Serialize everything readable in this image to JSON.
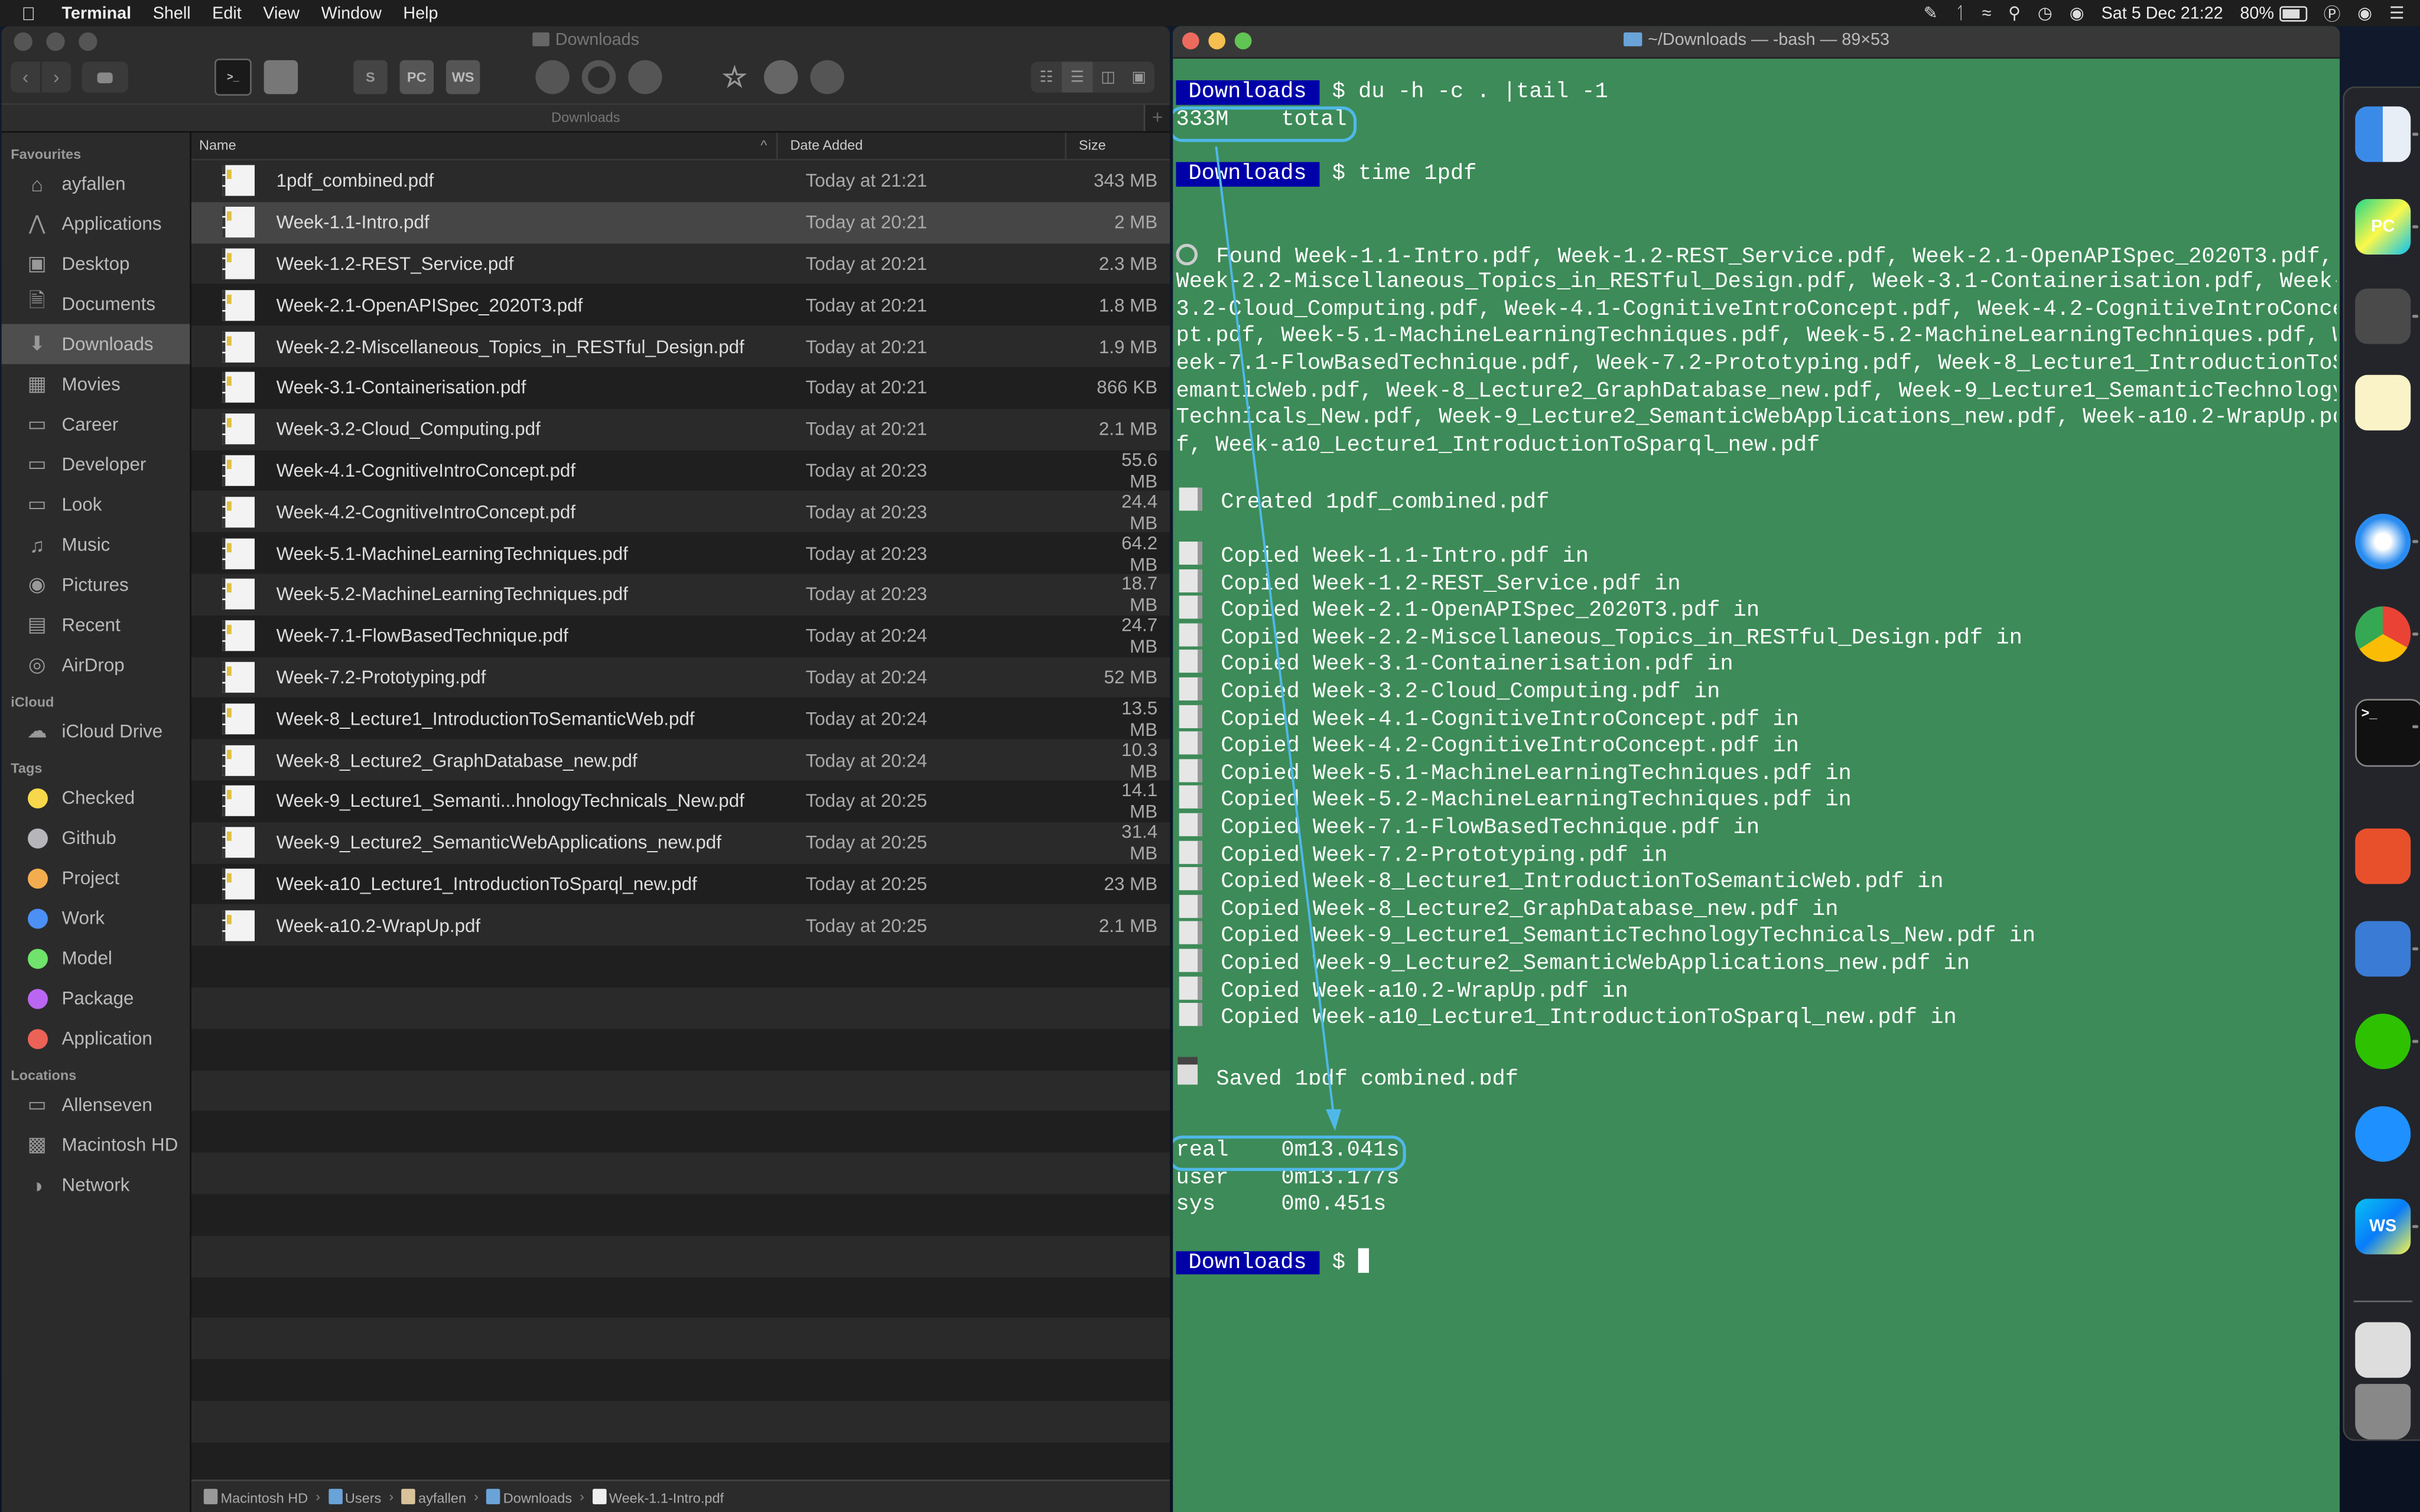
{
  "menubar": {
    "apple_icon": "apple-logo",
    "items": [
      "Terminal",
      "Shell",
      "Edit",
      "View",
      "Window",
      "Help"
    ],
    "status_icons": [
      "pen-icon",
      "bluetooth-icon",
      "wifi-icon",
      "spotlight-search-icon",
      "time-machine-icon",
      "owl-icon"
    ],
    "datetime": "Sat 5 Dec  21:22",
    "battery": "80%",
    "battery_percent": 80,
    "extra_icons": [
      "wordpress-icon",
      "wechat-icon",
      "control-center-icon"
    ]
  },
  "finder": {
    "title": "Downloads",
    "path_tab": "Downloads",
    "toolbar": {
      "back": "‹",
      "forward": "›",
      "tag_button": "tag",
      "app_icons": [
        "terminal",
        "trash-app",
        "sublime-text",
        "pycharm",
        "webstorm",
        "firefox",
        "opera",
        "edge",
        "imovie",
        "archive",
        "binoculars"
      ],
      "app_labels": {
        "pycharm": "PC",
        "webstorm": "WS",
        "terminal": ">_"
      },
      "view_modes": [
        "icon-view",
        "list-view",
        "column-view",
        "gallery-view"
      ],
      "active_view": "list-view"
    },
    "sidebar": {
      "sections": [
        {
          "title": "Favourites",
          "items": [
            {
              "label": "ayfallen",
              "icon": "home-icon"
            },
            {
              "label": "Applications",
              "icon": "applications-icon"
            },
            {
              "label": "Desktop",
              "icon": "desktop-icon"
            },
            {
              "label": "Documents",
              "icon": "documents-icon"
            },
            {
              "label": "Downloads",
              "icon": "downloads-icon",
              "selected": true
            },
            {
              "label": "Movies",
              "icon": "movies-icon"
            },
            {
              "label": "Career",
              "icon": "folder-icon"
            },
            {
              "label": "Developer",
              "icon": "folder-icon"
            },
            {
              "label": "Look",
              "icon": "folder-icon"
            },
            {
              "label": "Music",
              "icon": "music-icon"
            },
            {
              "label": "Pictures",
              "icon": "camera-icon"
            },
            {
              "label": "Recent",
              "icon": "recent-icon"
            },
            {
              "label": "AirDrop",
              "icon": "airdrop-icon"
            }
          ]
        },
        {
          "title": "iCloud",
          "items": [
            {
              "label": "iCloud Drive",
              "icon": "cloud-icon"
            }
          ]
        },
        {
          "title": "Tags",
          "items": [
            {
              "label": "Checked",
              "color": "#f7d84a"
            },
            {
              "label": "Github",
              "color": "#b5b5ba"
            },
            {
              "label": "Project",
              "color": "#f4ad4e"
            },
            {
              "label": "Work",
              "color": "#4c8ff5"
            },
            {
              "label": "Model",
              "color": "#6fe36b"
            },
            {
              "label": "Package",
              "color": "#bb66f2"
            },
            {
              "label": "Application",
              "color": "#ec6257"
            }
          ]
        },
        {
          "title": "Locations",
          "items": [
            {
              "label": "Allenseven",
              "icon": "laptop-icon"
            },
            {
              "label": "Macintosh HD",
              "icon": "harddisk-icon"
            },
            {
              "label": "Network",
              "icon": "network-icon"
            }
          ]
        }
      ]
    },
    "columns": {
      "name": "Name",
      "date": "Date Added",
      "size": "Size",
      "sort_indicator": "^"
    },
    "files": [
      {
        "name": "1pdf_combined.pdf",
        "date": "Today at 21:21",
        "size": "343 MB"
      },
      {
        "name": "Week-1.1-Intro.pdf",
        "date": "Today at 20:21",
        "size": "2 MB",
        "selected": true
      },
      {
        "name": "Week-1.2-REST_Service.pdf",
        "date": "Today at 20:21",
        "size": "2.3 MB"
      },
      {
        "name": "Week-2.1-OpenAPISpec_2020T3.pdf",
        "date": "Today at 20:21",
        "size": "1.8 MB"
      },
      {
        "name": "Week-2.2-Miscellaneous_Topics_in_RESTful_Design.pdf",
        "date": "Today at 20:21",
        "size": "1.9 MB"
      },
      {
        "name": "Week-3.1-Containerisation.pdf",
        "date": "Today at 20:21",
        "size": "866 KB"
      },
      {
        "name": "Week-3.2-Cloud_Computing.pdf",
        "date": "Today at 20:21",
        "size": "2.1 MB"
      },
      {
        "name": "Week-4.1-CognitiveIntroConcept.pdf",
        "date": "Today at 20:23",
        "size": "55.6 MB"
      },
      {
        "name": "Week-4.2-CognitiveIntroConcept.pdf",
        "date": "Today at 20:23",
        "size": "24.4 MB"
      },
      {
        "name": "Week-5.1-MachineLearningTechniques.pdf",
        "date": "Today at 20:23",
        "size": "64.2 MB"
      },
      {
        "name": "Week-5.2-MachineLearningTechniques.pdf",
        "date": "Today at 20:23",
        "size": "18.7 MB"
      },
      {
        "name": "Week-7.1-FlowBasedTechnique.pdf",
        "date": "Today at 20:24",
        "size": "24.7 MB"
      },
      {
        "name": "Week-7.2-Prototyping.pdf",
        "date": "Today at 20:24",
        "size": "52 MB"
      },
      {
        "name": "Week-8_Lecture1_IntroductionToSemanticWeb.pdf",
        "date": "Today at 20:24",
        "size": "13.5 MB"
      },
      {
        "name": "Week-8_Lecture2_GraphDatabase_new.pdf",
        "date": "Today at 20:24",
        "size": "10.3 MB"
      },
      {
        "name": "Week-9_Lecture1_Semanti...hnologyTechnicals_New.pdf",
        "date": "Today at 20:25",
        "size": "14.1 MB"
      },
      {
        "name": "Week-9_Lecture2_SemanticWebApplications_new.pdf",
        "date": "Today at 20:25",
        "size": "31.4 MB"
      },
      {
        "name": "Week-a10_Lecture1_IntroductionToSparql_new.pdf",
        "date": "Today at 20:25",
        "size": "23 MB"
      },
      {
        "name": "Week-a10.2-WrapUp.pdf",
        "date": "Today at 20:25",
        "size": "2.1 MB"
      }
    ],
    "pathbar": [
      "Macintosh HD",
      "Users",
      "ayfallen",
      "Downloads",
      "Week-1.1-Intro.pdf"
    ]
  },
  "terminal": {
    "title": "~/Downloads — -bash — 89×53",
    "prompt_dir": "Downloads",
    "prompt_symbol": "$",
    "lines": [
      {
        "type": "prompt",
        "cmd": "du -h -c . |tail -1"
      },
      {
        "type": "out",
        "text": "333M    total"
      },
      {
        "type": "blank"
      },
      {
        "type": "prompt",
        "cmd": "time 1pdf"
      },
      {
        "type": "blank"
      },
      {
        "type": "blank"
      },
      {
        "type": "out",
        "icon": "mag",
        "text": "Found Week-1.1-Intro.pdf, Week-1.2-REST_Service.pdf, Week-2.1-OpenAPISpec_2020T3.pdf,"
      },
      {
        "type": "out",
        "text": "Week-2.2-Miscellaneous_Topics_in_RESTful_Design.pdf, Week-3.1-Containerisation.pdf, Week-"
      },
      {
        "type": "out",
        "text": "3.2-Cloud_Computing.pdf, Week-4.1-CognitiveIntroConcept.pdf, Week-4.2-CognitiveIntroConce"
      },
      {
        "type": "out",
        "text": "pt.pdf, Week-5.1-MachineLearningTechniques.pdf, Week-5.2-MachineLearningTechniques.pdf, W"
      },
      {
        "type": "out",
        "text": "eek-7.1-FlowBasedTechnique.pdf, Week-7.2-Prototyping.pdf, Week-8_Lecture1_IntroductionToS"
      },
      {
        "type": "out",
        "text": "emanticWeb.pdf, Week-8_Lecture2_GraphDatabase_new.pdf, Week-9_Lecture1_SemanticTechnology"
      },
      {
        "type": "out",
        "text": "Technicals_New.pdf, Week-9_Lecture2_SemanticWebApplications_new.pdf, Week-a10.2-WrapUp.pd"
      },
      {
        "type": "out",
        "text": "f, Week-a10_Lecture1_IntroductionToSparql_new.pdf"
      },
      {
        "type": "blank"
      },
      {
        "type": "out",
        "icon": "file",
        "text": "Created 1pdf_combined.pdf"
      },
      {
        "type": "blank"
      },
      {
        "type": "out",
        "icon": "file",
        "text": "Copied Week-1.1-Intro.pdf in"
      },
      {
        "type": "out",
        "icon": "file",
        "text": "Copied Week-1.2-REST_Service.pdf in"
      },
      {
        "type": "out",
        "icon": "file",
        "text": "Copied Week-2.1-OpenAPISpec_2020T3.pdf in"
      },
      {
        "type": "out",
        "icon": "file",
        "text": "Copied Week-2.2-Miscellaneous_Topics_in_RESTful_Design.pdf in"
      },
      {
        "type": "out",
        "icon": "file",
        "text": "Copied Week-3.1-Containerisation.pdf in"
      },
      {
        "type": "out",
        "icon": "file",
        "text": "Copied Week-3.2-Cloud_Computing.pdf in"
      },
      {
        "type": "out",
        "icon": "file",
        "text": "Copied Week-4.1-CognitiveIntroConcept.pdf in"
      },
      {
        "type": "out",
        "icon": "file",
        "text": "Copied Week-4.2-CognitiveIntroConcept.pdf in"
      },
      {
        "type": "out",
        "icon": "file",
        "text": "Copied Week-5.1-MachineLearningTechniques.pdf in"
      },
      {
        "type": "out",
        "icon": "file",
        "text": "Copied Week-5.2-MachineLearningTechniques.pdf in"
      },
      {
        "type": "out",
        "icon": "file",
        "text": "Copied Week-7.1-FlowBasedTechnique.pdf in"
      },
      {
        "type": "out",
        "icon": "file",
        "text": "Copied Week-7.2-Prototyping.pdf in"
      },
      {
        "type": "out",
        "icon": "file",
        "text": "Copied Week-8_Lecture1_IntroductionToSemanticWeb.pdf in"
      },
      {
        "type": "out",
        "icon": "file",
        "text": "Copied Week-8_Lecture2_GraphDatabase_new.pdf in"
      },
      {
        "type": "out",
        "icon": "file",
        "text": "Copied Week-9_Lecture1_SemanticTechnologyTechnicals_New.pdf in"
      },
      {
        "type": "out",
        "icon": "file",
        "text": "Copied Week-9_Lecture2_SemanticWebApplications_new.pdf in"
      },
      {
        "type": "out",
        "icon": "file",
        "text": "Copied Week-a10.2-WrapUp.pdf in"
      },
      {
        "type": "out",
        "icon": "file",
        "text": "Copied Week-a10_Lecture1_IntroductionToSparql_new.pdf in"
      },
      {
        "type": "blank"
      },
      {
        "type": "out",
        "icon": "disk",
        "text": "Saved 1pdf_combined.pdf"
      },
      {
        "type": "blank"
      },
      {
        "type": "blank"
      },
      {
        "type": "out",
        "text": "real    0m13.041s"
      },
      {
        "type": "out",
        "text": "user    0m13.177s"
      },
      {
        "type": "out",
        "text": "sys     0m0.451s"
      },
      {
        "type": "blank"
      },
      {
        "type": "prompt",
        "cmd": "",
        "cursor": true
      }
    ],
    "annotation_color": "#4fb8e8"
  },
  "dock": {
    "items": [
      {
        "name": "finder",
        "running": true
      },
      {
        "name": "pycharm",
        "label": "PC",
        "running": true
      },
      {
        "name": "sublime-text",
        "running": true
      },
      {
        "name": "notes",
        "running": false
      },
      {
        "name": "safari",
        "running": true
      },
      {
        "name": "chrome",
        "running": true
      },
      {
        "name": "terminal",
        "label": ">_",
        "running": true
      },
      {
        "name": "pdf-app",
        "running": false
      },
      {
        "name": "dictionary",
        "running": true
      },
      {
        "name": "wechat",
        "running": true
      },
      {
        "name": "chat-app",
        "running": false
      },
      {
        "name": "webstorm",
        "label": "WS",
        "running": true
      },
      {
        "name": "preview-stack",
        "running": false
      },
      {
        "name": "trash",
        "running": false
      }
    ]
  }
}
